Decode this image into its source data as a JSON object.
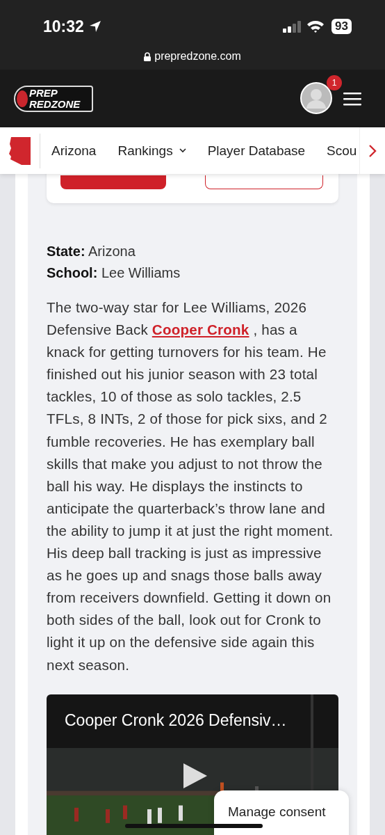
{
  "status_bar": {
    "time": "10:32",
    "battery": "93"
  },
  "browser": {
    "url": "prepredzone.com"
  },
  "header": {
    "logo_top": "PREP",
    "logo_bottom": "REDZONE",
    "notification_count": "1"
  },
  "nav": {
    "items": [
      {
        "label": "Arizona",
        "dropdown": false
      },
      {
        "label": "Rankings",
        "dropdown": true
      },
      {
        "label": "Player Database",
        "dropdown": false
      },
      {
        "label": "Scou",
        "dropdown": false
      }
    ]
  },
  "details": [
    {
      "label": "State:",
      "value": "Arizona"
    },
    {
      "label": "School:",
      "value": "Lee Williams"
    }
  ],
  "description": {
    "before": "The two-way star for Lee Williams, 2026 Defensive Back",
    "link": "Cooper Cronk",
    "after": ", has a knack for getting turnovers for his team. He finished out his junior season with 23 total tackles, 10 of those as solo tackles, 2.5 TFLs, 8 INTs, 2 of those for pick sixs, and 2 fumble recoveries. He has exemplary ball skills that make you adjust to not throw the ball his way. He displays the instincts to anticipate the quarterback’s throw lane and the ability to jump it at just the right moment. His deep ball tracking is just as impressive as he goes up and snags those balls away from receivers downfield. Getting it down on both sides of the ball, look out for Cronk to light it up on the defensive side again this next season."
  },
  "video": {
    "title": "Cooper Cronk 2026 Defensiv…"
  },
  "consent": {
    "label": "Manage consent"
  }
}
